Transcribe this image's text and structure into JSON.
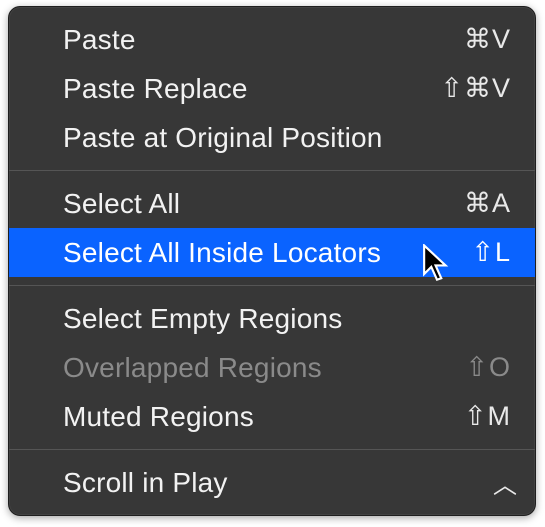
{
  "menu": {
    "groups": [
      [
        {
          "id": "paste",
          "label": "Paste",
          "shortcut": "⌘V",
          "disabled": false,
          "highlight": false
        },
        {
          "id": "paste-replace",
          "label": "Paste Replace",
          "shortcut": "⇧⌘V",
          "disabled": false,
          "highlight": false
        },
        {
          "id": "paste-original",
          "label": "Paste at Original Position",
          "shortcut": "",
          "disabled": false,
          "highlight": false
        }
      ],
      [
        {
          "id": "select-all",
          "label": "Select All",
          "shortcut": "⌘A",
          "disabled": false,
          "highlight": false
        },
        {
          "id": "select-all-locators",
          "label": "Select All Inside Locators",
          "shortcut": "⇧L",
          "disabled": false,
          "highlight": true
        }
      ],
      [
        {
          "id": "select-empty-regions",
          "label": "Select Empty Regions",
          "shortcut": "",
          "disabled": false,
          "highlight": false
        },
        {
          "id": "overlapped-regions",
          "label": "Overlapped Regions",
          "shortcut": "⇧O",
          "disabled": true,
          "highlight": false
        },
        {
          "id": "muted-regions",
          "label": "Muted Regions",
          "shortcut": "⇧M",
          "disabled": false,
          "highlight": false
        }
      ],
      [
        {
          "id": "scroll-in-play",
          "label": "Scroll in Play",
          "shortcut": "",
          "disabled": false,
          "highlight": false,
          "submenu": true
        }
      ]
    ]
  }
}
